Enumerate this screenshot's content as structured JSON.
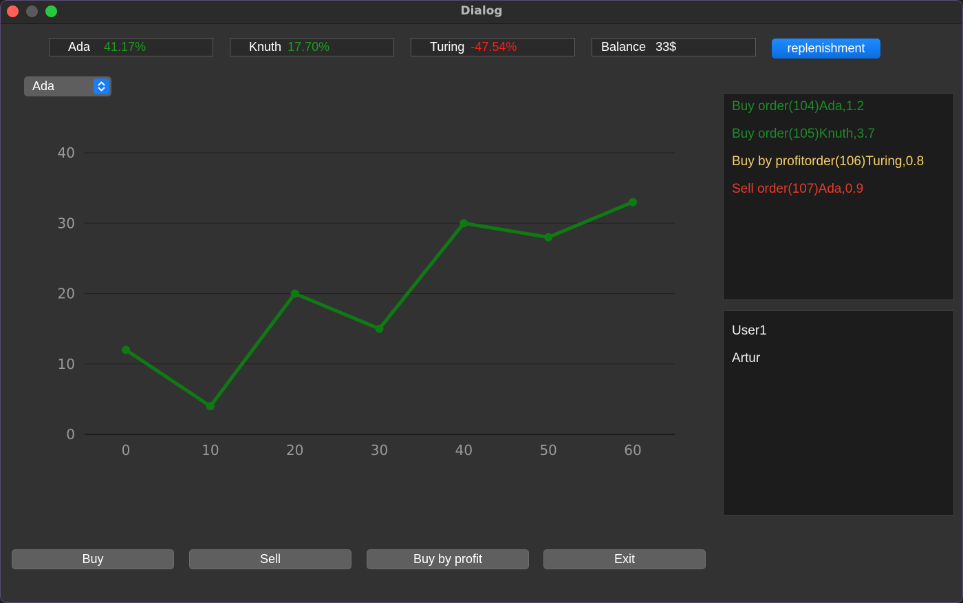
{
  "window": {
    "title": "Dialog"
  },
  "tickers": [
    {
      "name": "Ada",
      "value": "41.17%",
      "trend": "up"
    },
    {
      "name": "Knuth",
      "value": "17.70%",
      "trend": "up"
    },
    {
      "name": "Turing",
      "value": "-47.54%",
      "trend": "down"
    },
    {
      "name": "Balance",
      "value": "33$"
    }
  ],
  "replenishment_label": "replenishment",
  "selector": {
    "selected": "Ada"
  },
  "orders": [
    {
      "text": "Buy order(104)Ada,1.2",
      "color": "#1d8b2a"
    },
    {
      "text": "Buy order(105)Knuth,3.7",
      "color": "#1d8b2a"
    },
    {
      "text": "Buy by profitorder(106)Turing,0.8",
      "color": "#f2d06b"
    },
    {
      "text": "Sell order(107)Ada,0.9",
      "color": "#e43b2f"
    }
  ],
  "users": [
    "User1",
    "Artur"
  ],
  "buttons": {
    "buy": "Buy",
    "sell": "Sell",
    "buy_by_profit": "Buy by profit",
    "exit": "Exit"
  },
  "chart_data": {
    "type": "line",
    "x": [
      0,
      10,
      20,
      30,
      40,
      50,
      60
    ],
    "series": [
      {
        "values": [
          12,
          4,
          20,
          15,
          30,
          28,
          33
        ],
        "color": "#0f7a14"
      }
    ],
    "xticks": [
      "0",
      "10",
      "20",
      "30",
      "40",
      "50",
      "60"
    ],
    "yticks": [
      "0",
      "10",
      "20",
      "30",
      "40"
    ],
    "ylim": [
      0,
      40
    ],
    "xlim": [
      0,
      60
    ],
    "grid": "horizontal",
    "title": "",
    "xlabel": "",
    "ylabel": ""
  }
}
